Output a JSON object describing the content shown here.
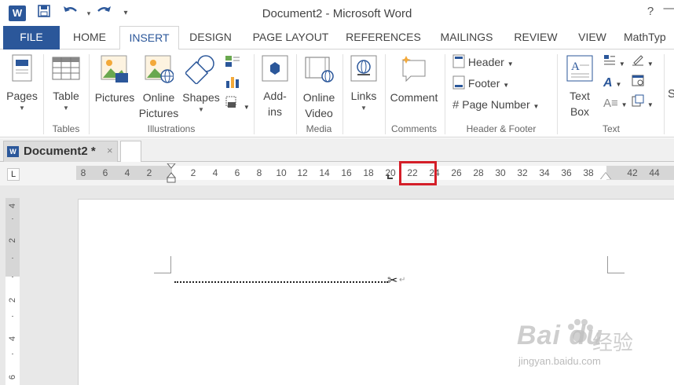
{
  "app": {
    "title": "Document2 - Microsoft Word",
    "word_icon_letter": "W",
    "help": "?",
    "minimize": "—"
  },
  "qat": {
    "save_icon": "save-icon",
    "undo_icon": "undo-icon",
    "redo_icon": "redo-icon",
    "customize_icon": "customize-icon"
  },
  "tabs": [
    {
      "label": "FILE"
    },
    {
      "label": "HOME"
    },
    {
      "label": "INSERT"
    },
    {
      "label": "DESIGN"
    },
    {
      "label": "PAGE LAYOUT"
    },
    {
      "label": "REFERENCES"
    },
    {
      "label": "MAILINGS"
    },
    {
      "label": "REVIEW"
    },
    {
      "label": "VIEW"
    },
    {
      "label": "MathTyp"
    }
  ],
  "ribbon": {
    "pages": "Pages",
    "table": "Table",
    "pictures": "Pictures",
    "online_pictures_1": "Online",
    "online_pictures_2": "Pictures",
    "shapes": "Shapes",
    "addins_1": "Add-",
    "addins_2": "ins",
    "online_video_1": "Online",
    "online_video_2": "Video",
    "links": "Links",
    "comment": "Comment",
    "header": "Header",
    "footer": "Footer",
    "page_number": "Page Number",
    "text_box_1": "Text",
    "text_box_2": "Box",
    "cut_letter": "S"
  },
  "groups": {
    "tables": "Tables",
    "illustrations": "Illustrations",
    "media": "Media",
    "comments": "Comments",
    "header_footer": "Header & Footer",
    "text": "Text"
  },
  "document_tab": {
    "name": "Document2 *",
    "close": "×",
    "icon_letter": "W"
  },
  "ruler": {
    "tab_selector": "L",
    "ticks": [
      "8",
      "6",
      "4",
      "2",
      "2",
      "4",
      "6",
      "8",
      "10",
      "12",
      "14",
      "16",
      "18",
      "20",
      "22",
      "24",
      "26",
      "28",
      "30",
      "32",
      "34",
      "36",
      "38",
      "42",
      "44"
    ],
    "highlighted": "22"
  },
  "vertical_ruler": {
    "ticks": [
      "4",
      "2",
      "2",
      "4",
      "6"
    ]
  },
  "document": {
    "scissors": "✂",
    "paragraph_mark": "↵"
  },
  "watermark": {
    "brand": "Bai du",
    "cn": "经验",
    "url": "jingyan.baidu.com"
  }
}
